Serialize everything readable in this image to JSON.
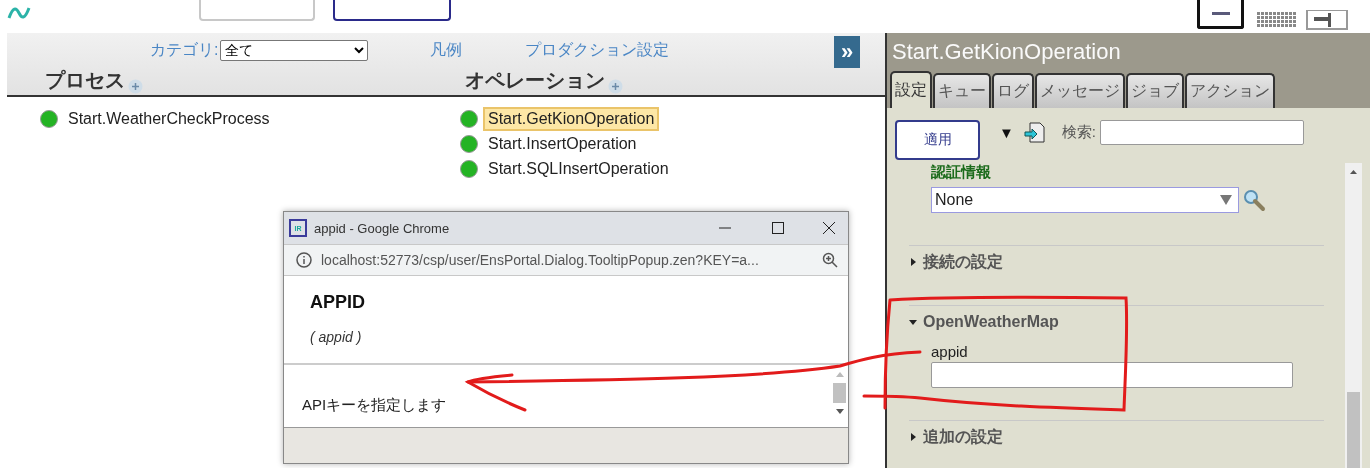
{
  "filter": {
    "label": "カテゴリ:",
    "value": "全て"
  },
  "links": [
    "凡例",
    "プロダクション設定"
  ],
  "expand_button": "»",
  "columns": [
    {
      "title": "プロセス",
      "items": [
        {
          "name": "Start.WeatherCheckProcess",
          "selected": false
        }
      ]
    },
    {
      "title": "オペレーション",
      "items": [
        {
          "name": "Start.GetKionOperation",
          "selected": true
        },
        {
          "name": "Start.InsertOperation",
          "selected": false
        },
        {
          "name": "Start.SQLInsertOperation",
          "selected": false
        }
      ]
    }
  ],
  "detail": {
    "title": "Start.GetKionOperation",
    "tabs": [
      {
        "label": "設定",
        "selected": true
      },
      {
        "label": "キュー",
        "selected": false
      },
      {
        "label": "ログ",
        "selected": false
      },
      {
        "label": "メッセージ",
        "selected": false
      },
      {
        "label": "ジョブ",
        "selected": false
      },
      {
        "label": "アクション",
        "selected": false
      }
    ],
    "apply_button": "適用",
    "menu_arrow": "▼",
    "search_label": "検索:",
    "sections": [
      {
        "kind": "select",
        "label": "認証情報",
        "value": "None"
      },
      {
        "kind": "group",
        "title": "接続の設定",
        "expanded": false
      },
      {
        "kind": "group",
        "title": "OpenWeatherMap",
        "expanded": true,
        "fields": [
          {
            "label": "appid"
          }
        ]
      },
      {
        "kind": "group",
        "title": "追加の設定",
        "expanded": false
      }
    ]
  },
  "popup": {
    "favicon_text": "IR",
    "title": "appid - Google Chrome",
    "url": "localhost:52773/csp/user/EnsPortal.Dialog.TooltipPopup.zen?KEY=a...",
    "heading": "APPID",
    "subheading": "( appid )",
    "description": "APIキーを指定します"
  }
}
